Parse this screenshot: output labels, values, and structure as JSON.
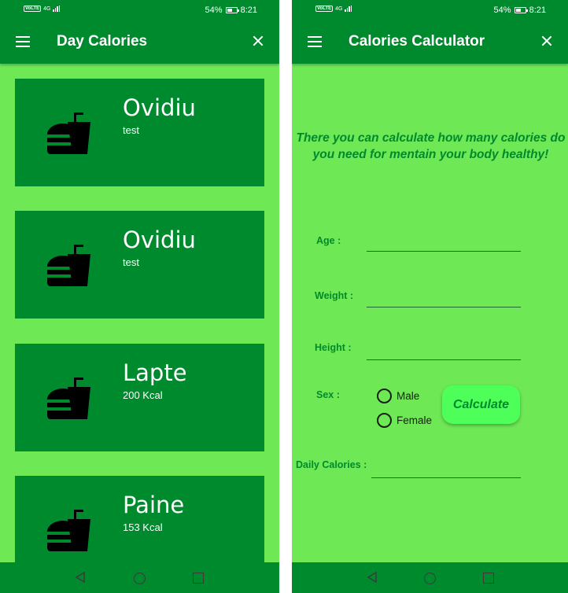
{
  "status_bar": {
    "battery": "54%",
    "time": "8:21",
    "network": "4G"
  },
  "day_calories": {
    "title": "Day Calories",
    "items": [
      {
        "name": "Ovidiu",
        "desc": "test"
      },
      {
        "name": "Ovidiu",
        "desc": "test"
      },
      {
        "name": "Lapte",
        "desc": "200 Kcal"
      },
      {
        "name": "Paine",
        "desc": "153 Kcal"
      }
    ]
  },
  "calculator": {
    "title": "Calories Calculator",
    "intro": "There you can calculate how many calories do you need for mentain your body healthy!",
    "age_label": "Age :",
    "weight_label": "Weight :",
    "height_label": "Height :",
    "sex_label": "Sex :",
    "male_label": "Male",
    "female_label": "Female",
    "calculate_label": "Calculate",
    "daily_label": "Daily Calories :"
  },
  "icons": {
    "menu": "menu-icon",
    "close": "close-icon",
    "food": "fastfood-icon",
    "back": "back-triangle-icon",
    "home": "home-circle-icon",
    "recent": "recent-square-icon"
  },
  "colors": {
    "bar": "#008a2e",
    "background": "#6fe855",
    "button": "#4eff5a"
  }
}
